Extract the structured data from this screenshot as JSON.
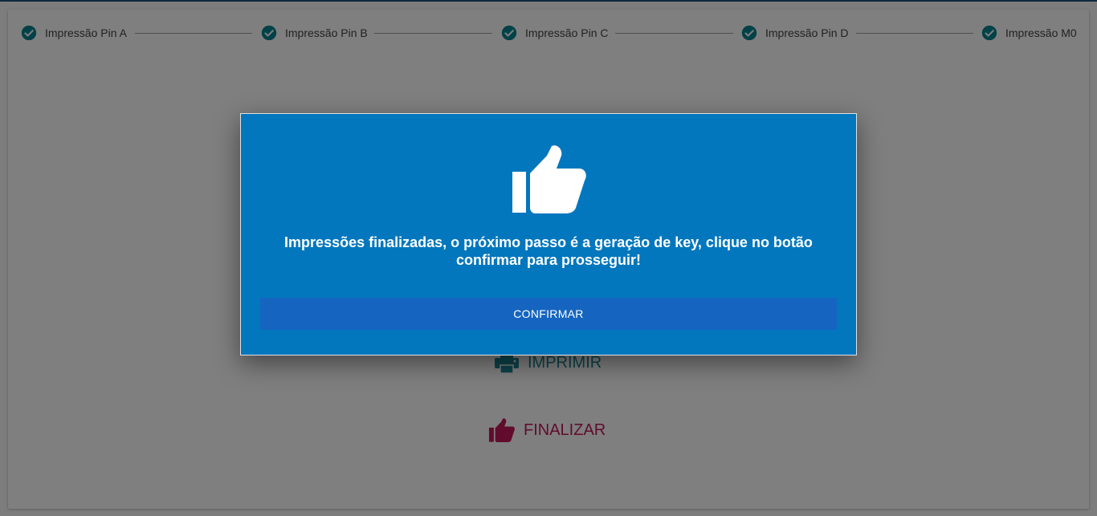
{
  "colors": {
    "step_check": "#00838f",
    "modal_bg": "#0277bd",
    "confirm_bg": "#1565c0",
    "print_color": "#1a8794",
    "finish_color": "#c2185b"
  },
  "stepper": {
    "steps": [
      {
        "label": "Impressão Pin A",
        "status": "completed",
        "icon": "check-circle-icon"
      },
      {
        "label": "Impressão Pin B",
        "status": "completed",
        "icon": "check-circle-icon"
      },
      {
        "label": "Impressão Pin C",
        "status": "completed",
        "icon": "check-circle-icon"
      },
      {
        "label": "Impressão Pin D",
        "status": "completed",
        "icon": "check-circle-icon"
      },
      {
        "label": "Impressão M0",
        "status": "completed",
        "icon": "check-circle-icon"
      }
    ]
  },
  "actions": {
    "print": {
      "label": "IMPRIMIR",
      "icon": "printer-icon"
    },
    "finish": {
      "label": "FINALIZAR",
      "icon": "thumbs-up-icon"
    }
  },
  "modal": {
    "icon": "thumbs-up-icon",
    "message": "Impressões finalizadas, o próximo passo é a geração de key, clique no botão confirmar para prosseguir!",
    "confirm_label": "CONFIRMAR"
  }
}
